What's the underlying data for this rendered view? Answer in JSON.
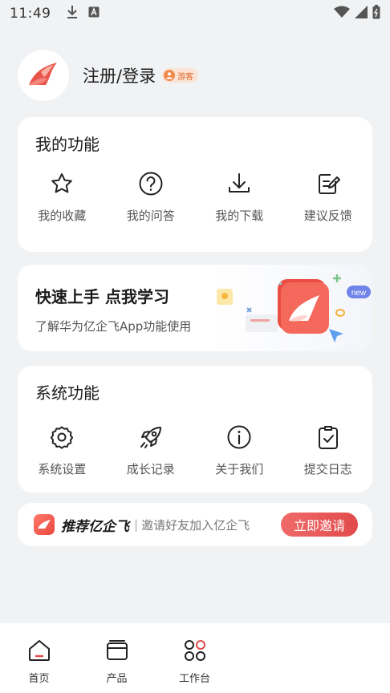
{
  "status_bar": {
    "time": "11:49"
  },
  "profile": {
    "login_label": "注册/登录",
    "badge": "游客"
  },
  "my_functions": {
    "title": "我的功能",
    "items": [
      {
        "label": "我的收藏",
        "icon": "star-icon"
      },
      {
        "label": "我的问答",
        "icon": "question-circle-icon"
      },
      {
        "label": "我的下载",
        "icon": "download-icon"
      },
      {
        "label": "建议反馈",
        "icon": "feedback-edit-icon"
      }
    ]
  },
  "promo": {
    "title": "快速上手 点我学习",
    "subtitle": "了解华为亿企飞App功能使用",
    "badge": "new"
  },
  "system_functions": {
    "title": "系统功能",
    "items": [
      {
        "label": "系统设置",
        "icon": "gear-icon"
      },
      {
        "label": "成长记录",
        "icon": "rocket-icon"
      },
      {
        "label": "关于我们",
        "icon": "info-circle-icon"
      },
      {
        "label": "提交日志",
        "icon": "clipboard-check-icon"
      }
    ]
  },
  "invite": {
    "brand": "推荐亿企飞",
    "separator": "|",
    "description": "邀请好友加入亿企飞",
    "button": "立即邀请"
  },
  "bottom_nav": {
    "items": [
      {
        "label": "首页",
        "icon": "home-icon"
      },
      {
        "label": "产品",
        "icon": "product-box-icon"
      },
      {
        "label": "工作台",
        "icon": "workbench-grid-icon"
      }
    ]
  },
  "colors": {
    "accent": "#e24a4a",
    "background": "#f1f2f4",
    "badge": "#ef8a4a"
  }
}
